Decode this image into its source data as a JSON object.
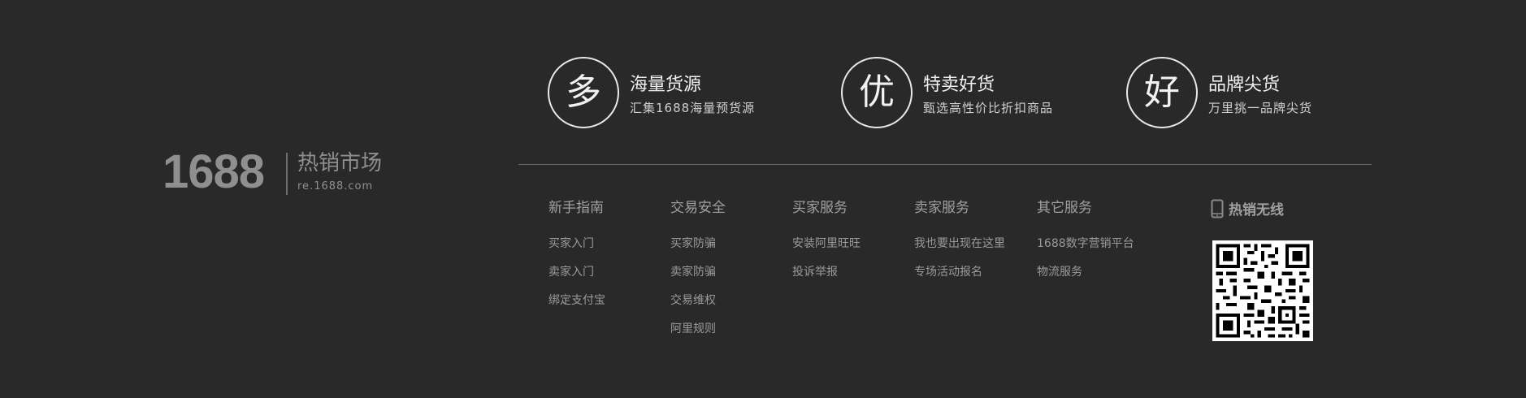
{
  "logo": {
    "number": "1688",
    "title": "热销市场",
    "url": "re.1688.com"
  },
  "features": [
    {
      "char": "多",
      "title": "海量货源",
      "subtitle": "汇集1688海量预货源"
    },
    {
      "char": "优",
      "title": "特卖好货",
      "subtitle": "甄选高性价比折扣商品"
    },
    {
      "char": "好",
      "title": "品牌尖货",
      "subtitle": "万里挑一品牌尖货"
    }
  ],
  "columns": [
    {
      "title": "新手指南",
      "links": [
        "买家入门",
        "卖家入门",
        "绑定支付宝"
      ]
    },
    {
      "title": "交易安全",
      "links": [
        "买家防骗",
        "卖家防骗",
        "交易维权",
        "阿里规则"
      ]
    },
    {
      "title": "买家服务",
      "links": [
        "安装阿里旺旺",
        "投诉举报"
      ]
    },
    {
      "title": "卖家服务",
      "links": [
        "我也要出现在这里",
        "专场活动报名"
      ]
    },
    {
      "title": "其它服务",
      "links": [
        "1688数字营销平台",
        "物流服务"
      ]
    }
  ],
  "mobile": {
    "title": "热销无线",
    "icon": "phone-icon",
    "qr": "qr-code"
  },
  "colors": {
    "background": "#292929",
    "text_bright": "#f0f0f0",
    "text_dim": "#9a9a9a"
  }
}
